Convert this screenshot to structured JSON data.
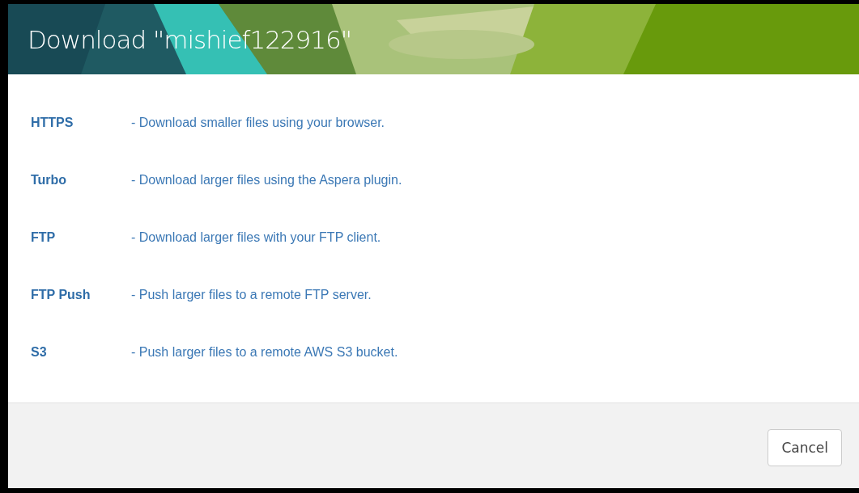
{
  "dialog": {
    "title": "Download \"mishief122916\"",
    "options": [
      {
        "name": "HTTPS",
        "description": "- Download smaller files using your browser."
      },
      {
        "name": "Turbo",
        "description": "- Download larger files using the Aspera plugin."
      },
      {
        "name": "FTP",
        "description": "- Download larger files with your FTP client."
      },
      {
        "name": "FTP Push",
        "description": "- Push larger files to a remote FTP server."
      },
      {
        "name": "S3",
        "description": "- Push larger files to a remote AWS S3 bucket."
      }
    ],
    "buttons": [
      "Cancel"
    ]
  }
}
